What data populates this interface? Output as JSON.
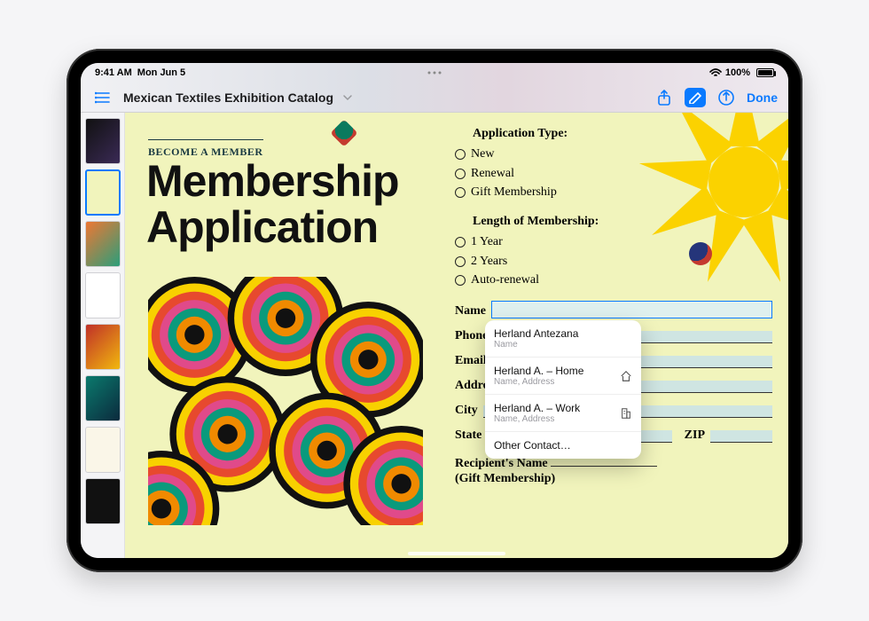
{
  "status": {
    "time": "9:41 AM",
    "date": "Mon Jun 5",
    "battery_pct": "100%"
  },
  "toolbar": {
    "doc_title": "Mexican Textiles Exhibition Catalog",
    "done": "Done"
  },
  "page": {
    "kicker": "BECOME A MEMBER",
    "headline_l1": "Membership",
    "headline_l2": "Application",
    "app_type": {
      "heading": "Application Type:",
      "opts": [
        "New",
        "Renewal",
        "Gift Membership"
      ]
    },
    "length": {
      "heading": "Length of Membership:",
      "opts": [
        "1 Year",
        "2 Years",
        "Auto-renewal"
      ]
    },
    "fields": {
      "name": "Name",
      "phone": "Phone",
      "email": "Email",
      "address": "Address",
      "city": "City",
      "state": "State",
      "zip": "ZIP"
    },
    "recipient_l1": "Recipient's Name",
    "recipient_l2": "(Gift Membership)"
  },
  "autofill": {
    "items": [
      {
        "title": "Herland Antezana",
        "sub": "Name",
        "icon": ""
      },
      {
        "title": "Herland A. – Home",
        "sub": "Name, Address",
        "icon": "home"
      },
      {
        "title": "Herland A. – Work",
        "sub": "Name, Address",
        "icon": "work"
      }
    ],
    "other": "Other Contact…"
  }
}
